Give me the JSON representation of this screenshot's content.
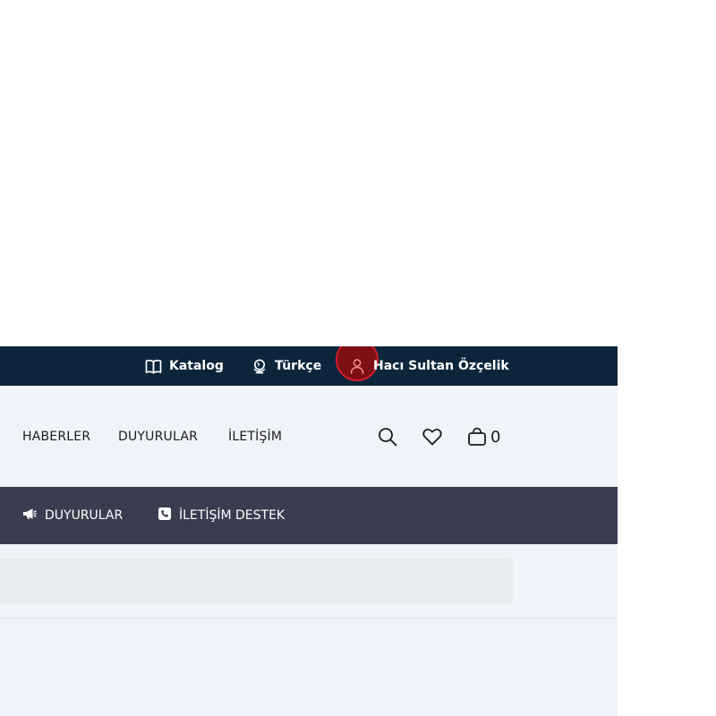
{
  "topbar": {
    "catalog_label": "Katalog",
    "language_label": "Türkçe",
    "user_label": "Hacı Sultan Özçelik"
  },
  "nav": {
    "items": [
      {
        "label": "HABERLER"
      },
      {
        "label": "DUYURULAR"
      },
      {
        "label": "İLETİŞİM"
      }
    ],
    "cart_count": "0"
  },
  "subnav": {
    "items": [
      {
        "label": "DUYURULAR",
        "icon": "megaphone-icon"
      },
      {
        "label": "İLETİŞİM DESTEK",
        "icon": "phone-icon"
      }
    ]
  },
  "colors": {
    "topbar_bg": "#0c253b",
    "subnav_bg": "#3a3d4f",
    "header_bg": "#f0f3fa",
    "highlight": "#d11d2a"
  }
}
